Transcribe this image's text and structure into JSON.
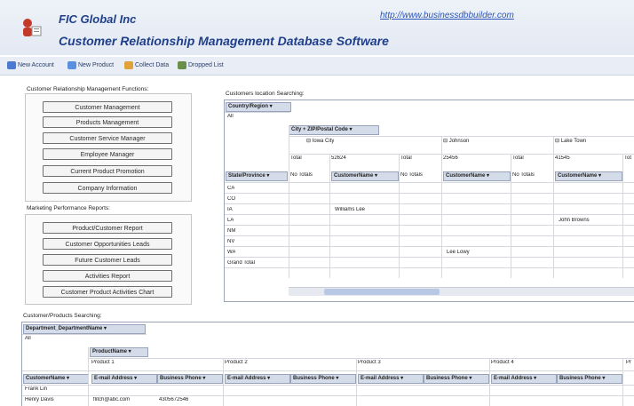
{
  "header": {
    "company": "FIC Global Inc",
    "product": "Customer Relationship Management Database Software",
    "url": "http://www.businessdbbuilder.com"
  },
  "toolbar": [
    {
      "label": "New Account",
      "icon": "account-icon",
      "color": "#4a7bd0"
    },
    {
      "label": "New Product",
      "icon": "product-icon",
      "color": "#5d8fe0"
    },
    {
      "label": "Collect Data",
      "icon": "collect-icon",
      "color": "#e0a33a"
    },
    {
      "label": "Dropped List",
      "icon": "list-icon",
      "color": "#6a8f4a"
    }
  ],
  "crm_functions": {
    "title": "Customer Relationship Management Functions:",
    "buttons": [
      "Customer Management",
      "Products Management",
      "Customer Service Manager",
      "Employee Manager",
      "Current Product Promotion",
      "Company Information"
    ]
  },
  "marketing": {
    "title": "Marketing Performance Reports:",
    "buttons": [
      "Product/Customer Report",
      "Customer Opportunities Leads",
      "Future Customer Leads",
      "Activities Report",
      "Customer Product Activities Chart"
    ]
  },
  "location_search": {
    "title": "Customers location Searching:",
    "country_field": "Country/Region",
    "country_value": "All",
    "city_field": "City + ZIP/Postal Code",
    "cities": [
      {
        "name": "⊟ Iowa City",
        "zip": "52624",
        "total": "Total"
      },
      {
        "name": "⊟ Johnson",
        "zip": "25456",
        "total": "Total"
      },
      {
        "name": "⊟ Lake Town",
        "zip": "41545",
        "total": "Tot"
      }
    ],
    "total_label": "Total",
    "state_field": "State/Province",
    "no_totals": "No Totals",
    "customer_name": "CustomerName",
    "states": [
      "CA",
      "CO",
      "IA",
      "LA",
      "NM",
      "NV",
      "WA",
      "Grand Total"
    ],
    "entries": [
      {
        "row": 2,
        "col": 0,
        "text": "Williams Lee"
      },
      {
        "row": 3,
        "col": 2,
        "text": "John Browns"
      },
      {
        "row": 6,
        "col": 1,
        "text": "Lee Lowy"
      }
    ]
  },
  "products_search": {
    "title": "Customer/Products Searching:",
    "dept_field": "Department_DepartmentName",
    "dept_value": "All",
    "product_field": "ProductName",
    "products": [
      "Product 1",
      "Product 2",
      "Product 3",
      "Product 4",
      "Pr"
    ],
    "customer_field": "CustomerName",
    "email_col": "E-mail Address",
    "phone_col": "Business Phone",
    "rows": [
      {
        "name": "Frank Lin",
        "email": "",
        "phone": ""
      },
      {
        "name": "Henry Davis",
        "email": "flitch@abc.com",
        "phone": "4305672546"
      }
    ]
  }
}
